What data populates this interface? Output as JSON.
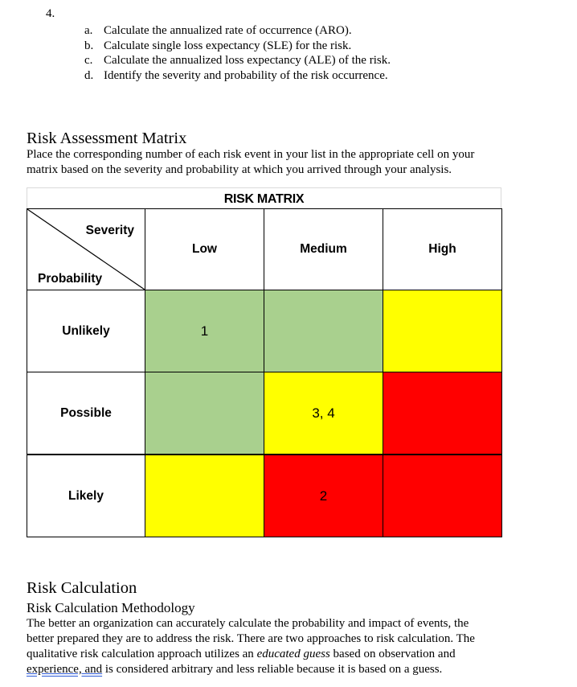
{
  "question": {
    "number": "4.",
    "items": [
      {
        "letter": "a.",
        "text": "Calculate the annualized rate of occurrence (ARO)."
      },
      {
        "letter": "b.",
        "text": "Calculate single loss expectancy (SLE) for the risk."
      },
      {
        "letter": "c.",
        "text": "Calculate the annualized loss expectancy (ALE) of the risk."
      },
      {
        "letter": "d.",
        "text": "Identify the severity and probability of the risk occurrence."
      }
    ]
  },
  "risk_assessment": {
    "heading": "Risk Assessment Matrix",
    "lines": [
      "Place the corresponding number of each risk event in your list in the appropriate cell on your",
      "matrix based on the severity and probability at which you arrived through your analysis."
    ]
  },
  "matrix": {
    "title": "RISK MATRIX",
    "corner_severity": "Severity",
    "corner_probability": "Probability",
    "columns": [
      "Low",
      "Medium",
      "High"
    ],
    "colors": {
      "green": "#A9D08E",
      "yellow": "#FFFF00",
      "red": "#FF0000",
      "white": "#FFFFFF"
    },
    "rows": [
      {
        "label": "Unlikely",
        "cells": [
          {
            "value": "1",
            "color": "green"
          },
          {
            "value": "",
            "color": "green"
          },
          {
            "value": "",
            "color": "yellow"
          }
        ]
      },
      {
        "label": "Possible",
        "cells": [
          {
            "value": "",
            "color": "green"
          },
          {
            "value": "3, 4",
            "color": "yellow"
          },
          {
            "value": "",
            "color": "red"
          }
        ]
      },
      {
        "label": "Likely",
        "cells": [
          {
            "value": "",
            "color": "yellow"
          },
          {
            "value": "2",
            "color": "red"
          },
          {
            "value": "",
            "color": "red"
          }
        ]
      }
    ]
  },
  "risk_calculation": {
    "heading": "Risk Calculation",
    "subheading": "Risk Calculation Methodology",
    "line1": "The better an organization can accurately calculate the probability and impact of events, the",
    "line2": "better prepared they are to address the risk. There are two approaches to risk calculation. The",
    "line3_before": "qualitative risk calculation approach utilizes an ",
    "line3_italic": "educated guess",
    "line3_after": " based on observation and",
    "line4_underlined": "experience, and",
    "line4_after": " is considered arbitrary and less reliable because it is based on a guess."
  }
}
